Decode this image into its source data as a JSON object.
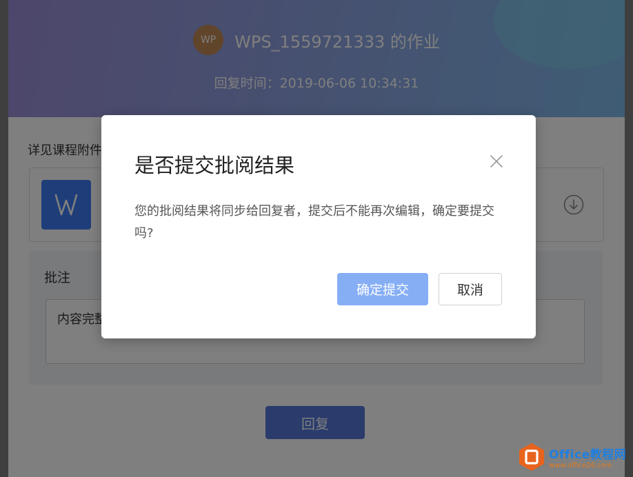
{
  "header": {
    "avatar_initials": "WP",
    "title": "WPS_1559721333 的作业",
    "reply_time": "回复时间：2019-06-06 10:34:31"
  },
  "content": {
    "hint": "详见课程附件",
    "attachment_icon": "wps-writer-doc-icon",
    "download_icon": "download-circle-icon"
  },
  "comment": {
    "label": "批注",
    "value": "内容完整"
  },
  "reply_button": "回复",
  "modal": {
    "title": "是否提交批阅结果",
    "message": "您的批阅结果将同步给回复者，提交后不能再次编辑，确定要提交吗?",
    "confirm_label": "确定提交",
    "cancel_label": "取消",
    "close_icon": "close-icon"
  },
  "watermark": {
    "brand": "Office教程网",
    "url": "www.office26.com"
  },
  "colors": {
    "accent": "#3f7cf3",
    "confirm_button": "#86aef5",
    "reply_button": "#5577d8",
    "avatar": "#c28a55"
  }
}
